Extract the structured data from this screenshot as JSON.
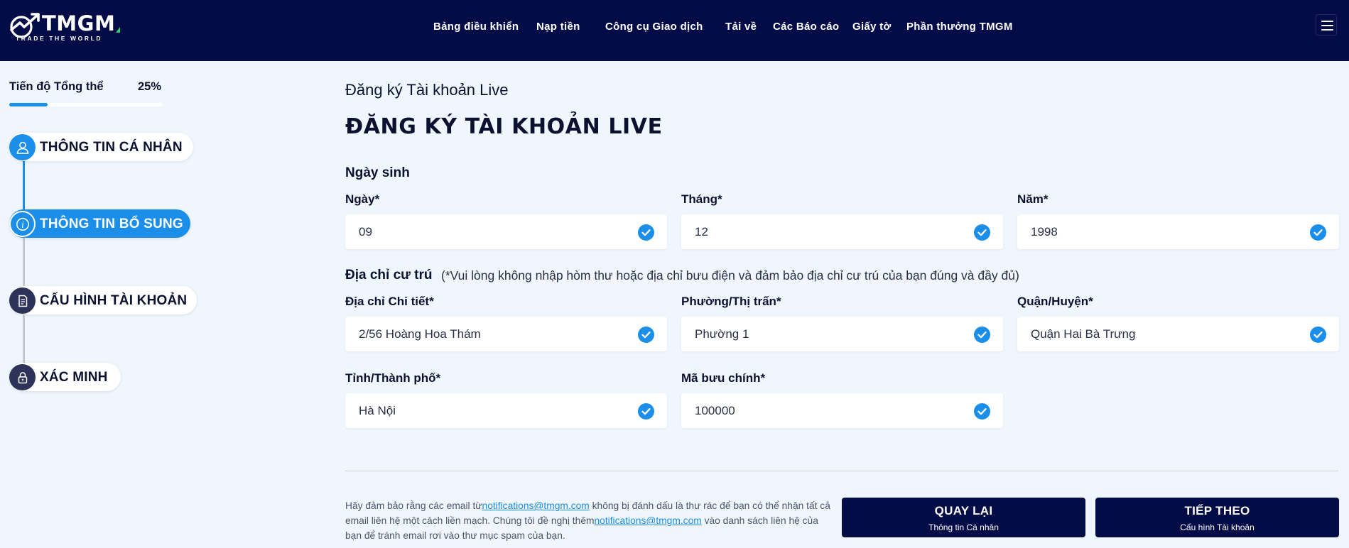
{
  "header": {
    "logo_text": "TMGM",
    "logo_tagline": "TRADE THE WORLD",
    "nav": [
      {
        "label": "Bảng điều khiển"
      },
      {
        "label": "Nạp tiền"
      },
      {
        "label": "Công cụ Giao dịch"
      },
      {
        "label": "Tải về"
      },
      {
        "label": "Các Báo cáo"
      },
      {
        "label": "Giấy tờ"
      },
      {
        "label": "Phần thưởng TMGM"
      }
    ],
    "menu_icon": "hamburger-menu-icon"
  },
  "sidebar": {
    "progress_label": "Tiến độ Tổng thể",
    "progress_text": "25%",
    "progress_fraction": 0.25,
    "steps": [
      {
        "label": "THÔNG TIN CÁ NHÂN",
        "icon": "user-icon",
        "state": "done"
      },
      {
        "label": "THÔNG TIN BỔ SUNG",
        "icon": "info-icon",
        "state": "active"
      },
      {
        "label": "CẤU HÌNH TÀI KHOẢN",
        "icon": "document-icon",
        "state": "pending"
      },
      {
        "label": "XÁC MINH",
        "icon": "lock-icon",
        "state": "pending"
      }
    ]
  },
  "main": {
    "breadcrumb": "Đăng ký Tài khoản Live",
    "title": "ĐĂNG KÝ TÀI KHOẢN LIVE",
    "dob": {
      "section": "Ngày sinh",
      "day_label": "Ngày*",
      "day_value": "09",
      "month_label": "Tháng*",
      "month_value": "12",
      "year_label": "Năm*",
      "year_value": "1998"
    },
    "address": {
      "section": "Địa chỉ cư trú",
      "note": "(*Vui lòng không nhập hòm thư hoặc địa chỉ bưu điện và đảm bảo địa chỉ cư trú của bạn đúng và đầy đủ)",
      "detail_label": "Địa chỉ Chi tiết*",
      "detail_value": "2/56 Hoàng Hoa Thám",
      "ward_label": "Phường/Thị trấn*",
      "ward_value": "Phường 1",
      "district_label": "Quận/Huyện*",
      "district_value": "Quận Hai Bà Trưng",
      "city_label": "Tỉnh/Thành phố*",
      "city_value": "Hà Nội",
      "postal_label": "Mã bưu chính*",
      "postal_value": "100000"
    },
    "footer": {
      "note_1": "Hãy đảm bảo rằng các email từ",
      "email_1": "notifications@tmgm.com",
      "note_2": " không bị đánh dấu là thư rác để bạn có thể nhận tất cả email liên hệ một cách liền mạch. Chúng tôi đề nghị thêm",
      "email_2": "notifications@tmgm.com",
      "note_3": " vào danh sách liên hệ của bạn để tránh email rơi vào thư mục spam của bạn.",
      "back_label": "QUAY LẠI",
      "back_sub": "Thông tin Cá nhân",
      "next_label": "TIẾP THEO",
      "next_sub": "Cấu hình Tài khoản"
    }
  },
  "colors": {
    "header_bg": "#040c47",
    "accent": "#1a8ee8",
    "page_bg": "#eff6fd"
  }
}
